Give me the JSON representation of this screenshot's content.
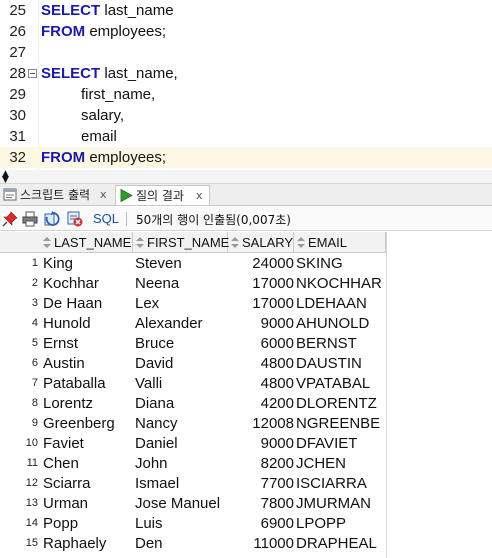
{
  "editor": {
    "lines": [
      {
        "num": "25",
        "keyword": "SELECT",
        "text": " last_name"
      },
      {
        "num": "26",
        "keyword": "FROM",
        "text": " employees;"
      },
      {
        "num": "27",
        "keyword": "",
        "text": ""
      },
      {
        "num": "28",
        "keyword": "SELECT",
        "text": " last_name,"
      },
      {
        "num": "29",
        "keyword": "",
        "text": "first_name,"
      },
      {
        "num": "30",
        "keyword": "",
        "text": "salary,"
      },
      {
        "num": "31",
        "keyword": "",
        "text": "email"
      },
      {
        "num": "32",
        "keyword": "FROM",
        "text": " employees;"
      }
    ]
  },
  "tabs": {
    "script_output": "스크립트 출력",
    "query_result": "질의 결과",
    "close": "x"
  },
  "toolbar": {
    "sql_label": "SQL",
    "status": "50개의 행이 인출됨(0,007초)"
  },
  "grid": {
    "columns": [
      "LAST_NAME",
      "FIRST_NAME",
      "SALARY",
      "EMAIL"
    ],
    "rows": [
      {
        "n": "1",
        "last": "King",
        "first": "Steven",
        "salary": "24000",
        "email": "SKING"
      },
      {
        "n": "2",
        "last": "Kochhar",
        "first": "Neena",
        "salary": "17000",
        "email": "NKOCHHAR"
      },
      {
        "n": "3",
        "last": "De Haan",
        "first": "Lex",
        "salary": "17000",
        "email": "LDEHAAN"
      },
      {
        "n": "4",
        "last": "Hunold",
        "first": "Alexander",
        "salary": "9000",
        "email": "AHUNOLD"
      },
      {
        "n": "5",
        "last": "Ernst",
        "first": "Bruce",
        "salary": "6000",
        "email": "BERNST"
      },
      {
        "n": "6",
        "last": "Austin",
        "first": "David",
        "salary": "4800",
        "email": "DAUSTIN"
      },
      {
        "n": "7",
        "last": "Pataballa",
        "first": "Valli",
        "salary": "4800",
        "email": "VPATABAL"
      },
      {
        "n": "8",
        "last": "Lorentz",
        "first": "Diana",
        "salary": "4200",
        "email": "DLORENTZ"
      },
      {
        "n": "9",
        "last": "Greenberg",
        "first": "Nancy",
        "salary": "12008",
        "email": "NGREENBE"
      },
      {
        "n": "10",
        "last": "Faviet",
        "first": "Daniel",
        "salary": "9000",
        "email": "DFAVIET"
      },
      {
        "n": "11",
        "last": "Chen",
        "first": "John",
        "salary": "8200",
        "email": "JCHEN"
      },
      {
        "n": "12",
        "last": "Sciarra",
        "first": "Ismael",
        "salary": "7700",
        "email": "ISCIARRA"
      },
      {
        "n": "13",
        "last": "Urman",
        "first": "Jose Manuel",
        "salary": "7800",
        "email": "JMURMAN"
      },
      {
        "n": "14",
        "last": "Popp",
        "first": "Luis",
        "salary": "6900",
        "email": "LPOPP"
      },
      {
        "n": "15",
        "last": "Raphaely",
        "first": "Den",
        "salary": "11000",
        "email": "DRAPHEAL"
      }
    ]
  },
  "colors": {
    "keyword": "#1a1aa6",
    "current_line": "#fdf8e4",
    "run_icon": "#2e9b2e"
  }
}
